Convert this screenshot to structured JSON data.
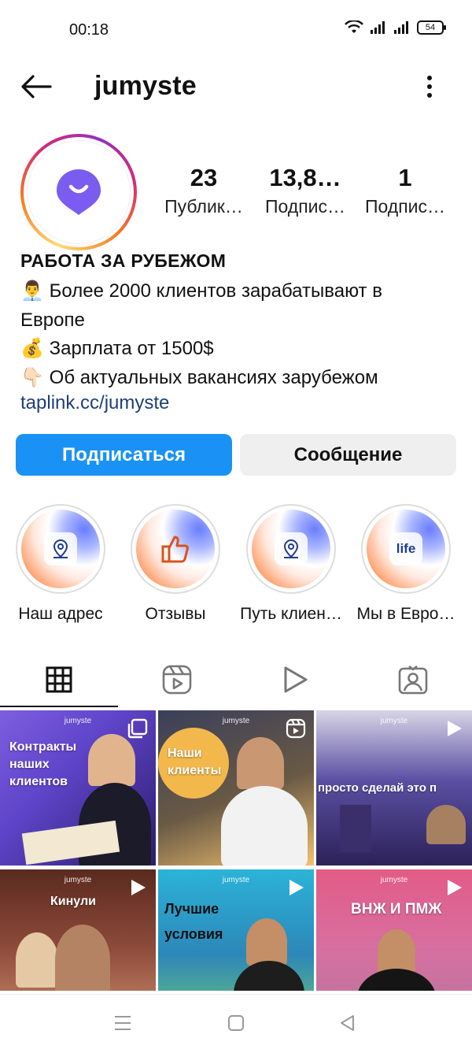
{
  "status_bar": {
    "time": "00:18",
    "battery": "54"
  },
  "header": {
    "username": "jumyste"
  },
  "profile": {
    "stats": [
      {
        "value": "23",
        "label": "Публик…"
      },
      {
        "value": "13,8…",
        "label": "Подпис…"
      },
      {
        "value": "1",
        "label": "Подпис…"
      }
    ],
    "name": "РАБОТА ЗА РУБЕЖОМ",
    "bio": [
      {
        "emoji": "👨‍💼",
        "text": "Более 2000 клиентов зарабатывают в"
      },
      {
        "emoji": "",
        "text": "Европе"
      },
      {
        "emoji": "💰",
        "text": "Зарплата от 1500$"
      },
      {
        "emoji": "👇🏻",
        "text": "Об актуальных вакансиях зарубежом"
      }
    ],
    "link": "taplink.cc/jumyste"
  },
  "actions": {
    "follow_label": "Подписаться",
    "message_label": "Сообщение"
  },
  "highlights": [
    {
      "label": "Наш адрес",
      "icon": "map-pin-icon"
    },
    {
      "label": "Отзывы",
      "icon": "thumbs-up-icon"
    },
    {
      "label": "Путь клиен…",
      "icon": "map-pin-icon"
    },
    {
      "label": "Мы в Евро…",
      "icon": "life-badge",
      "badge_text": "life"
    }
  ],
  "tabs": [
    {
      "name": "posts-grid",
      "icon": "grid-icon",
      "active": true
    },
    {
      "name": "reels",
      "icon": "reels-icon",
      "active": false
    },
    {
      "name": "videos",
      "icon": "play-icon",
      "active": false
    },
    {
      "name": "tagged",
      "icon": "tagged-user-icon",
      "active": false
    }
  ],
  "posts": [
    {
      "brand": "jumyste",
      "text": "Контракты\nнаших\nклиентов",
      "type": "carousel"
    },
    {
      "brand": "jumyste",
      "text": "Наши\nклиенты",
      "type": "reel"
    },
    {
      "brand": "jumyste",
      "text": "просто сделай это п",
      "type": "video"
    },
    {
      "brand": "jumyste",
      "text": "Кинули",
      "type": "video"
    },
    {
      "brand": "jumyste",
      "text": "Лучшие\nусловия",
      "type": "video"
    },
    {
      "brand": "jumyste",
      "text": "ВНЖ И ПМЖ",
      "type": "video"
    }
  ],
  "colors": {
    "accent": "#1a92f5",
    "link": "#1d3f7a",
    "brand_purple": "#7b5cf0"
  }
}
